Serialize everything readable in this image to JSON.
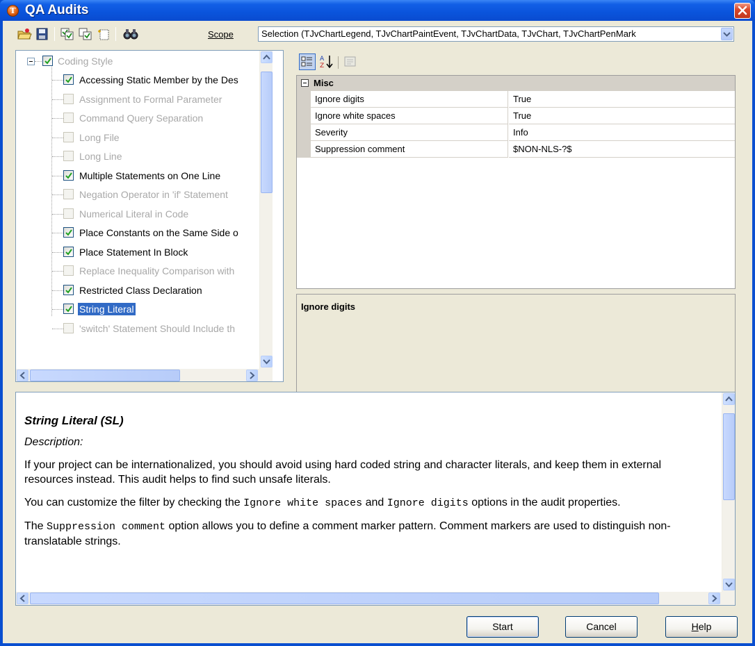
{
  "window": {
    "title": "QA Audits",
    "app_icon_letter": "T"
  },
  "toolbar": {
    "scope_label": "Scope",
    "scope_value": "Selection (TJvChartLegend, TJvChartPaintEvent, TJvChartData, TJvChart, TJvChartPenMark"
  },
  "tree": {
    "root_label": "Coding Style",
    "items": [
      {
        "label": "Accessing Static Member by the Des",
        "checked": true
      },
      {
        "label": "Assignment to Formal Parameter",
        "checked": false
      },
      {
        "label": "Command Query Separation",
        "checked": false
      },
      {
        "label": "Long File",
        "checked": false
      },
      {
        "label": "Long Line",
        "checked": false
      },
      {
        "label": "Multiple Statements on One Line",
        "checked": true
      },
      {
        "label": "Negation Operator in 'if' Statement",
        "checked": false
      },
      {
        "label": "Numerical Literal in Code",
        "checked": false
      },
      {
        "label": "Place Constants on the Same Side o",
        "checked": true
      },
      {
        "label": "Place Statement In Block",
        "checked": true
      },
      {
        "label": "Replace Inequality Comparison with",
        "checked": false
      },
      {
        "label": "Restricted Class Declaration",
        "checked": true
      },
      {
        "label": "String Literal",
        "checked": true,
        "selected": true
      },
      {
        "label": "'switch' Statement Should Include th",
        "checked": false
      }
    ]
  },
  "properties": {
    "category": "Misc",
    "rows": [
      {
        "name": "Ignore digits",
        "value": "True"
      },
      {
        "name": "Ignore white spaces",
        "value": "True"
      },
      {
        "name": "Severity",
        "value": "Info"
      },
      {
        "name": "Suppression comment",
        "value": "$NON-NLS-?$"
      }
    ],
    "help_title": "Ignore digits"
  },
  "description": {
    "heading": "String Literal (SL)",
    "subheading": "Description:",
    "p1": "If your project can be internationalized, you should avoid using hard coded string and character literals, and keep them in external resources instead. This audit helps to find such unsafe literals.",
    "p2_a": "You can customize the filter by checking the ",
    "p2_code1": "Ignore white spaces",
    "p2_b": " and ",
    "p2_code2": "Ignore digits",
    "p2_c": " options in the audit properties.",
    "p3_a": "The ",
    "p3_code": "Suppression comment",
    "p3_b": " option allows you to define a comment marker pattern. Comment markers are used to distinguish non-translatable strings."
  },
  "buttons": {
    "start": "Start",
    "cancel": "Cancel",
    "help": "Help"
  },
  "colors": {
    "title_bar": "#0a54dc",
    "face": "#ece9d8",
    "selection": "#316ac5",
    "check": "#21a121"
  }
}
